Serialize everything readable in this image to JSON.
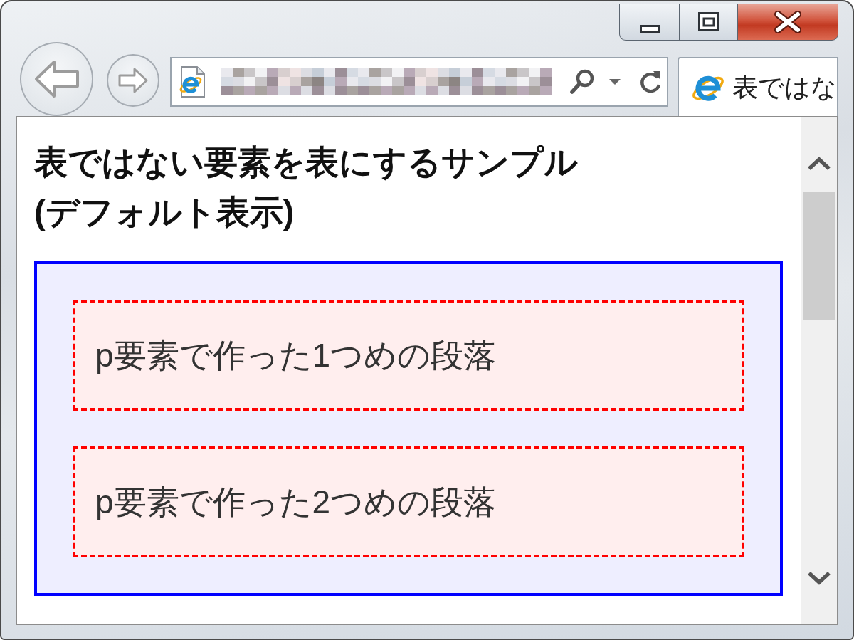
{
  "tabs": [
    {
      "title": "表ではな",
      "selected": true
    }
  ],
  "page": {
    "heading": "表ではない要素を表にするサンプル(デフォルト表示)",
    "paragraphs": [
      "p要素で作った1つめの段落",
      "p要素で作った2つめの段落"
    ]
  }
}
